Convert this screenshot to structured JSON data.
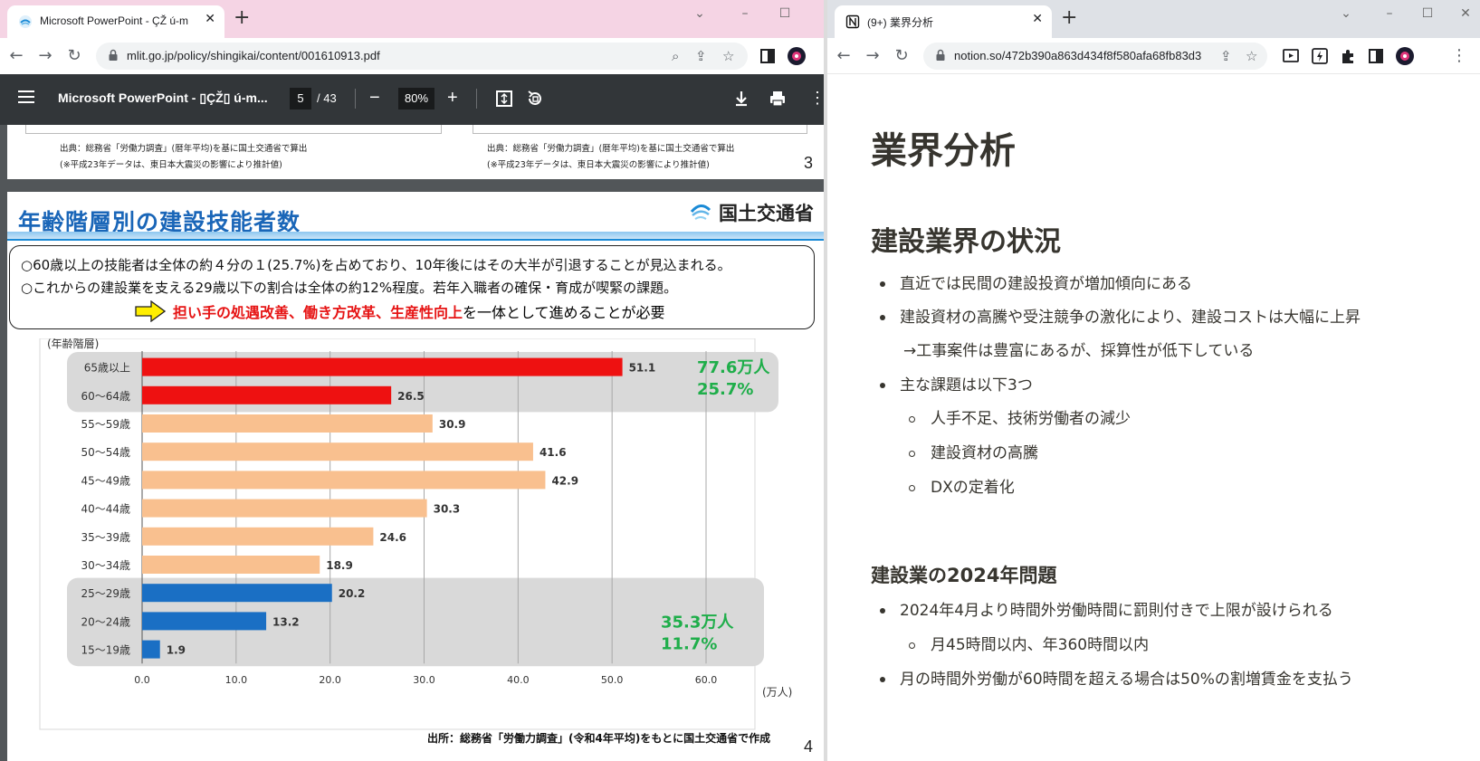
{
  "left_browser": {
    "tab_title": "Microsoft PowerPoint - ÇŽ ú-m",
    "url": "mlit.go.jp/policy/shingikai/content/001610913.pdf",
    "pdf": {
      "doc_title": "Microsoft PowerPoint - ▯ÇŽ▯ ú-m...",
      "current_page": "5",
      "total_pages": "/ 43",
      "zoom": "80%"
    },
    "page3": {
      "source_left": "出典：総務省「労働力調査」(暦年平均)を基に国土交通省で算出",
      "note_left": "(※平成23年データは、東日本大震災の影響により推計値)",
      "source_right": "出典：総務省「労働力調査」(暦年平均)を基に国土交通省で算出",
      "note_right": "(※平成23年データは、東日本大震災の影響により推計値)",
      "page_number": "3"
    },
    "page4": {
      "heading": "年齢階層別の建設技能者数",
      "logo_text": "国土交通省",
      "summary_line1": "○60歳以上の技能者は全体の約４分の１(25.7%)を占めており、10年後にはその大半が引退することが見込まれる。",
      "summary_line2": "○これからの建設業を支える29歳以下の割合は全体の約12%程度。若年入職者の確保・育成が喫緊の課題。",
      "action_red": "担い手の処遇改善、働き方改革、生産性向上",
      "action_rest": "を一体として進めることが必要",
      "source": "出所：総務省「労働力調査」(令和4年平均)をもとに国土交通省で作成",
      "page_number": "4"
    }
  },
  "chart_data": {
    "type": "bar",
    "orientation": "horizontal",
    "ylabel": "(年齢階層)",
    "xlabel": "(万人)",
    "xlim": [
      0,
      60
    ],
    "xticks": [
      "0.0",
      "10.0",
      "20.0",
      "30.0",
      "40.0",
      "50.0",
      "60.0"
    ],
    "categories": [
      "65歳以上",
      "60～64歳",
      "55～59歳",
      "50～54歳",
      "45～49歳",
      "40～44歳",
      "35～39歳",
      "30～34歳",
      "25～29歳",
      "20～24歳",
      "15～19歳"
    ],
    "values": [
      51.1,
      26.5,
      30.9,
      41.6,
      42.9,
      30.3,
      24.6,
      18.9,
      20.2,
      13.2,
      1.9
    ],
    "value_labels": [
      "51.1",
      "26.5",
      "30.9",
      "41.6",
      "42.9",
      "30.3",
      "24.6",
      "18.9",
      "20.2",
      "13.2",
      "1.9"
    ],
    "bar_colors": [
      "#ee1111",
      "#ee1111",
      "#f9c08f",
      "#f9c08f",
      "#f9c08f",
      "#f9c08f",
      "#f9c08f",
      "#f9c08f",
      "#1a6fc4",
      "#1a6fc4",
      "#1a6fc4"
    ],
    "grid": true,
    "annotations": [
      {
        "line1": "77.6万人",
        "line2": "25.7%",
        "color": "#1fae4a"
      },
      {
        "line1": "35.3万人",
        "line2": "11.7%",
        "color": "#1fae4a"
      }
    ]
  },
  "right_browser": {
    "tab_title": "(9+) 業界分析",
    "url": "notion.so/472b390a863d434f8f580afa68fb83d3",
    "notion": {
      "page_title": "業界分析",
      "section1_heading": "建設業界の状況",
      "bullets1": [
        "直近では民間の建設投資が増加傾向にある",
        "建設資材の高騰や受注競争の激化により、建設コストは大幅に上昇"
      ],
      "continuation": "→工事案件は豊富にあるが、採算性が低下している",
      "bullet_main_issues": "主な課題は以下3つ",
      "sub_bullets": [
        "人手不足、技術労働者の減少",
        "建設資材の高騰",
        "DXの定着化"
      ],
      "section2_heading": "建設業の2024年問題",
      "bullets2": [
        "2024年4月より時間外労働時間に罰則付きで上限が設けられる",
        "月の時間外労働が60時間を超える場合は50%の割増賃金を支払う"
      ],
      "sub_bullet2": "月45時間以内、年360時間以内"
    }
  }
}
